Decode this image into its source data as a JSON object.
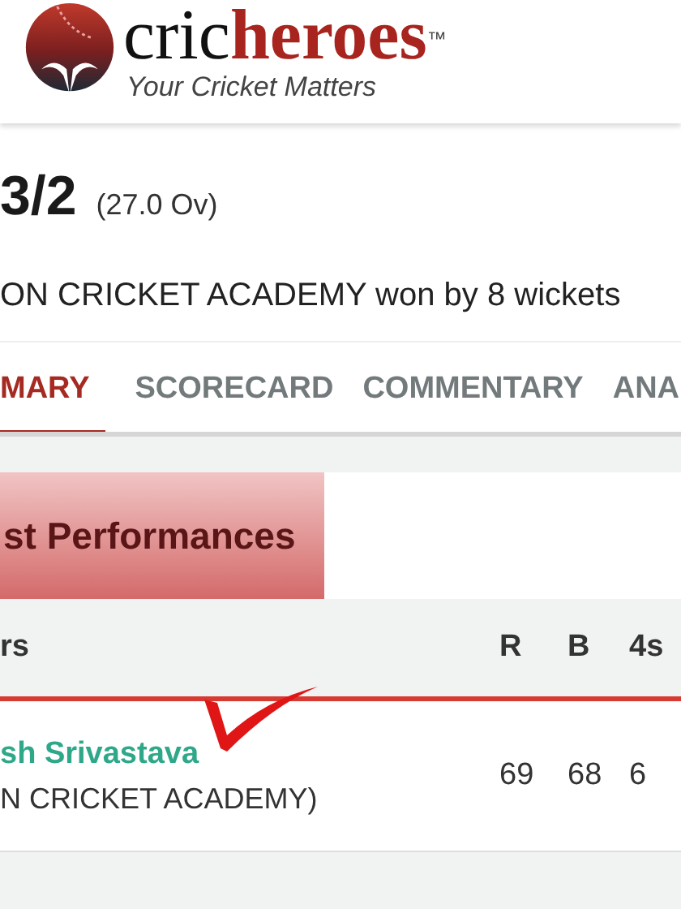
{
  "header": {
    "logo": {
      "part_1": "cric",
      "part_2": "heroes",
      "trademark": "™"
    },
    "tagline": "Your Cricket Matters"
  },
  "score": {
    "runs": "3/2",
    "overs": "(27.0 Ov)"
  },
  "result": "ON CRICKET ACADEMY won by 8 wickets",
  "tabs": [
    {
      "label": "MARY",
      "selected": true
    },
    {
      "label": "SCORECARD",
      "selected": false
    },
    {
      "label": "COMMENTARY",
      "selected": false
    },
    {
      "label": "ANA",
      "selected": false
    }
  ],
  "section": {
    "title": "st Performances"
  },
  "table": {
    "columns": [
      "rs",
      "R",
      "B",
      "4s"
    ],
    "rows": [
      {
        "player": "sh Srivastava",
        "team": "N CRICKET ACADEMY)",
        "values": [
          "69",
          "68",
          "6"
        ]
      }
    ]
  }
}
